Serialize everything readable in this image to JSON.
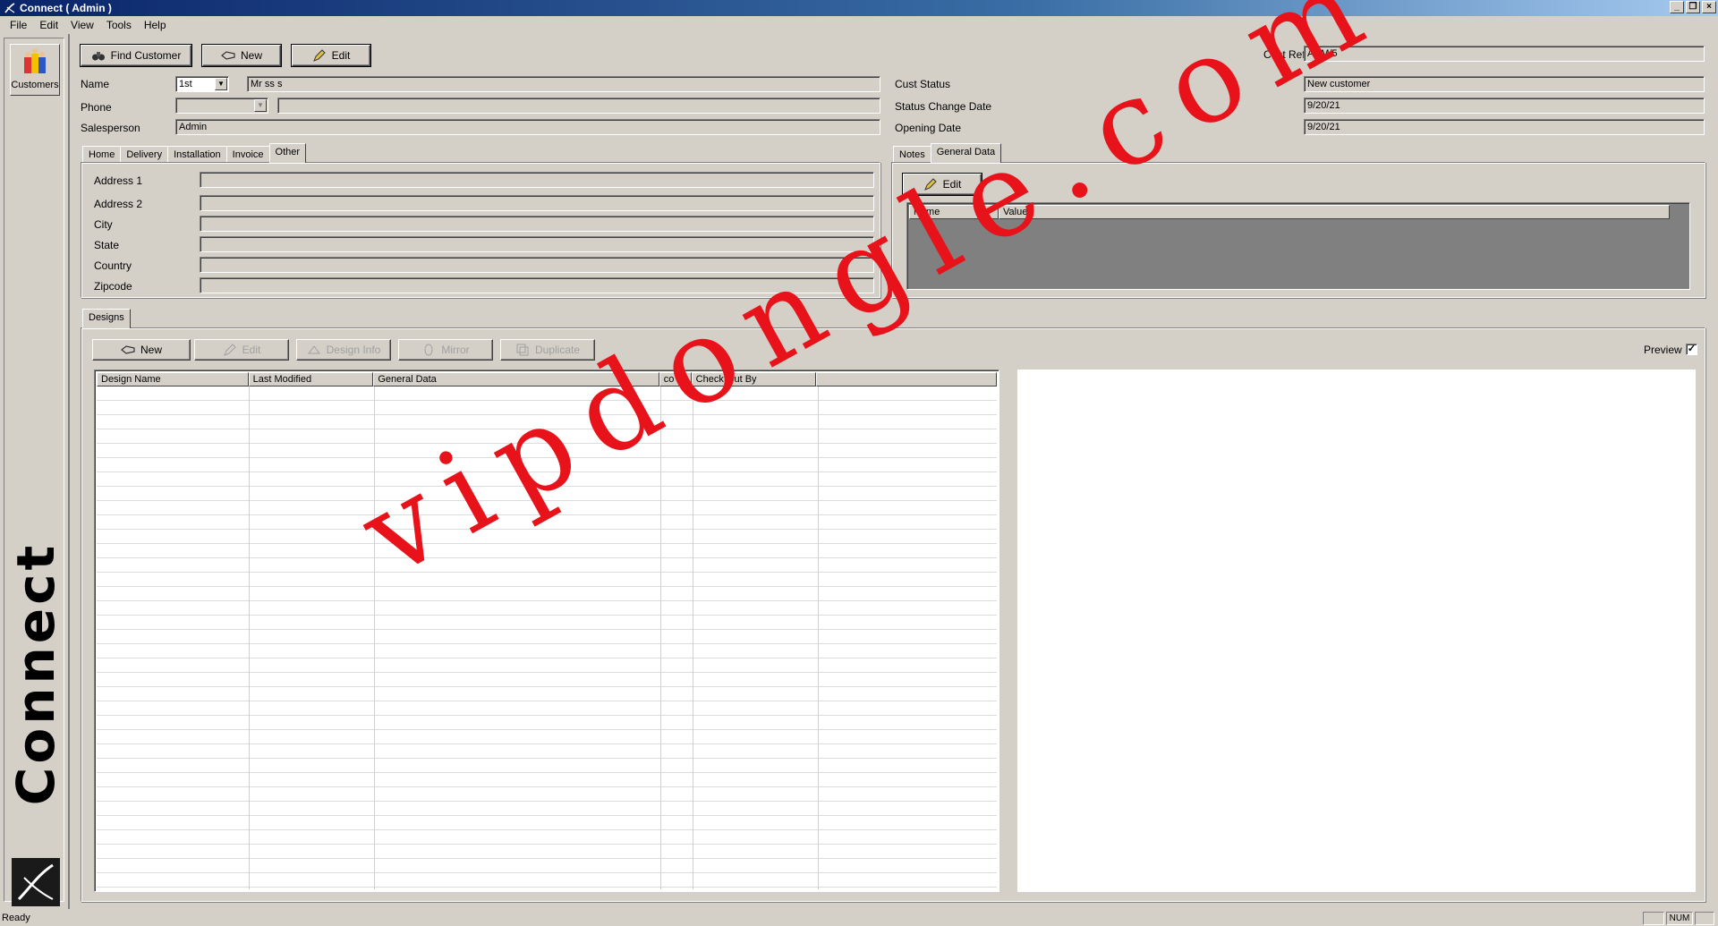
{
  "window": {
    "title": "Connect   ( Admin )",
    "controls": [
      "_",
      "❐",
      "×"
    ]
  },
  "menu": [
    "File",
    "Edit",
    "View",
    "Tools",
    "Help"
  ],
  "sidebar": {
    "customers_label": "Customers",
    "brand_text": "Connect"
  },
  "toolbar": {
    "find_customer": "Find Customer",
    "new": "New",
    "edit": "Edit"
  },
  "customer": {
    "name_label": "Name",
    "title_value": "1st",
    "name_value": "Mr ss s",
    "phone_label": "Phone",
    "phone_type_value": "",
    "phone_value": "",
    "salesperson_label": "Salesperson",
    "salesperson_value": "Admin",
    "cust_ref_label": "Cust Ref",
    "cust_ref_value": "ADM/5",
    "cust_status_label": "Cust Status",
    "cust_status_value": "New customer",
    "status_change_label": "Status Change Date",
    "status_change_value": "9/20/21",
    "opening_date_label": "Opening Date",
    "opening_date_value": "9/20/21"
  },
  "address_tabs": [
    "Home",
    "Delivery",
    "Installation",
    "Invoice",
    "Other"
  ],
  "address_active_tab": "Other",
  "address": {
    "address1_label": "Address 1",
    "address2_label": "Address 2",
    "city_label": "City",
    "state_label": "State",
    "country_label": "Country",
    "zipcode_label": "Zipcode"
  },
  "general_tabs": [
    "Notes",
    "General Data"
  ],
  "general_active_tab": "General Data",
  "general_data": {
    "edit": "Edit",
    "columns": [
      "Name",
      "Value"
    ]
  },
  "designs": {
    "tab": "Designs",
    "buttons": {
      "new": "New",
      "edit": "Edit",
      "design_info": "Design Info",
      "mirror": "Mirror",
      "duplicate": "Duplicate"
    },
    "preview_label": "Preview",
    "preview_checked": "✓",
    "columns": [
      "Design Name",
      "Last Modified",
      "General Data",
      "co",
      "Check Out By",
      ""
    ]
  },
  "status": {
    "text": "Ready",
    "num": "NUM"
  },
  "watermark": "vipdongle.com"
}
